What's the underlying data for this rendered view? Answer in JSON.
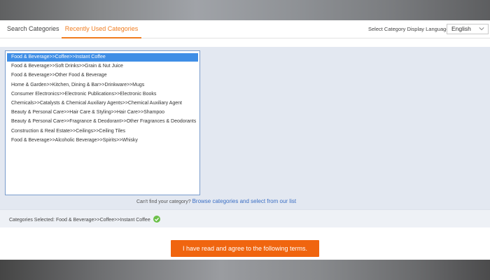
{
  "tabs": [
    {
      "label": "Search Categories",
      "active": false
    },
    {
      "label": "Recently Used Categories",
      "active": true
    }
  ],
  "language": {
    "label": "Select Category Display Language",
    "selected": "English"
  },
  "categories": [
    "Food & Beverage>>Coffee>>Instant Coffee",
    "Food & Beverage>>Soft Drinks>>Grain & Nut Juice",
    "Food & Beverage>>Other Food & Beverage",
    "Home & Garden>>Kitchen, Dining & Bar>>Drinkware>>Mugs",
    "Consumer Electronics>>Electronic Publications>>Electronic Books",
    "Chemicals>>Catalysts & Chemical Auxiliary Agents>>Chemical Auxiliary Agent",
    "Beauty & Personal Care>>Hair Care & Styling>>Hair Care>>Shampoo",
    "Beauty & Personal Care>>Fragrance & Deodorant>>Other Fragrances & Deodorants",
    "Construction & Real Estate>>Ceilings>>Ceiling Tiles",
    "Food & Beverage>>Alcoholic Beverage>>Spirits>>Whisky"
  ],
  "selected_index": 0,
  "cant_find": {
    "prefix": "Can't find your category?",
    "link": "Browse categories and select from our list"
  },
  "selection": {
    "label": "Categories Selected:",
    "value": "Food & Beverage>>Coffee>>Instant Coffee"
  },
  "agree_button": "I have read and agree to the following terms.",
  "colors": {
    "accent": "#f07c1f",
    "button": "#f0650f",
    "selected_row": "#3f8ee6",
    "link": "#3a6ec4",
    "check": "#6cc04a"
  }
}
